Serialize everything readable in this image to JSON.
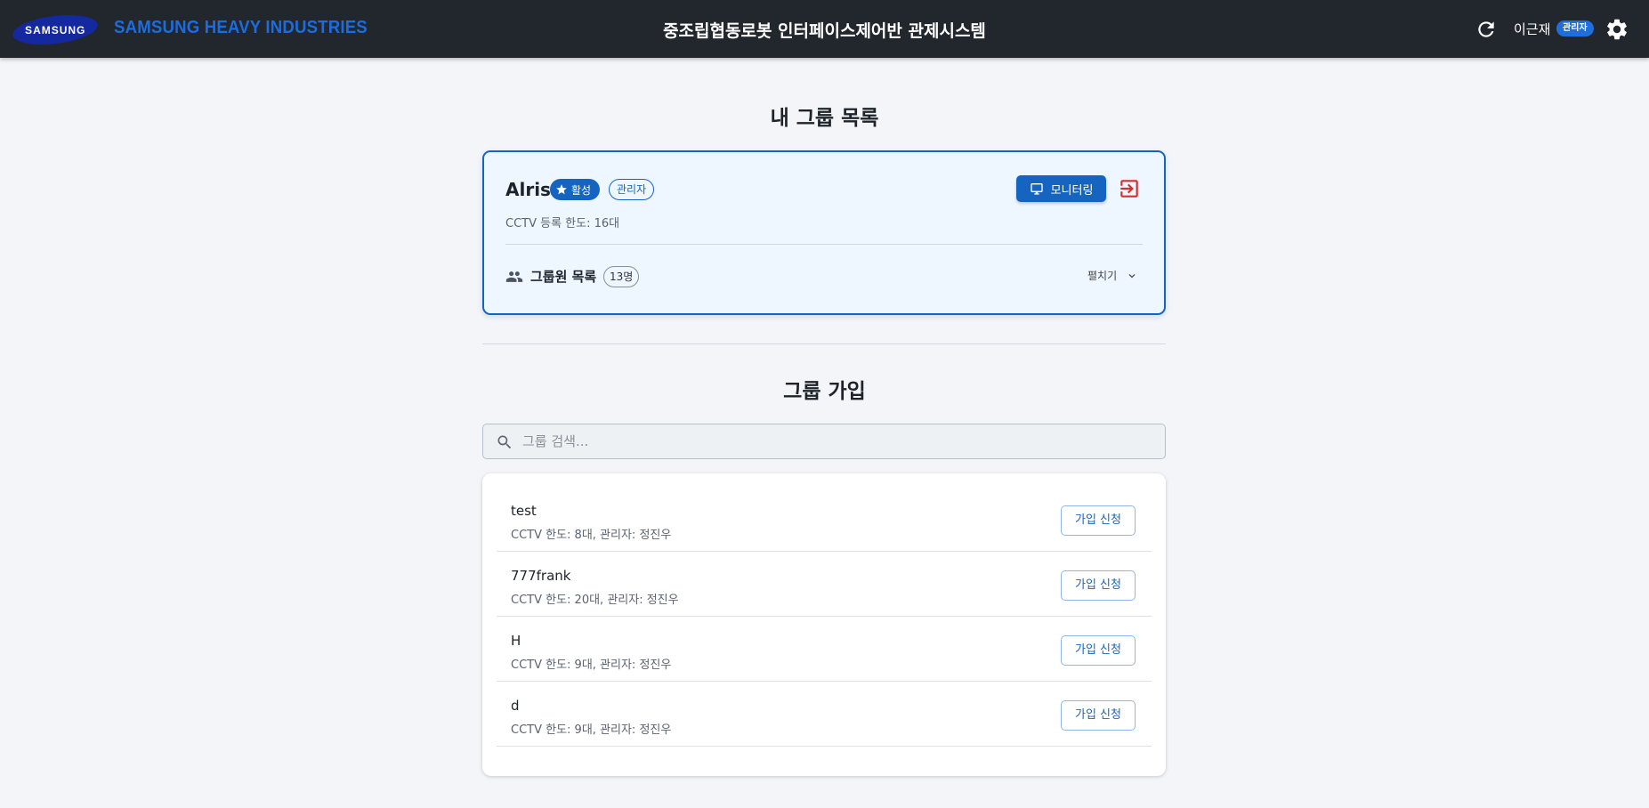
{
  "header": {
    "logo_text": "SAMSUNG",
    "brand": "SAMSUNG HEAVY INDUSTRIES",
    "title": "중조립협동로봇 인터페이스제어반 관제시스템",
    "user_name": "이근재",
    "user_role": "관리자",
    "icons": [
      "refresh-icon",
      "gear-icon"
    ]
  },
  "my_groups": {
    "title": "내 그룹 목록",
    "group": {
      "name": "Alris",
      "active_label": "활성",
      "role_label": "관리자",
      "monitor_label": "모니터링",
      "cctv_limit": "CCTV 등록 한도: 16대",
      "members_label": "그룹원 목록",
      "members_count": "13명",
      "expand_label": "펼치기"
    }
  },
  "join": {
    "title": "그룹 가입",
    "search_placeholder": "그룹 검색...",
    "groups": [
      {
        "name": "test",
        "desc": "CCTV 한도: 8대, 관리자: 정진우",
        "button": "가입 신청"
      },
      {
        "name": "777frank",
        "desc": "CCTV 한도: 20대, 관리자: 정진우",
        "button": "가입 신청"
      },
      {
        "name": "H",
        "desc": "CCTV 한도: 9대, 관리자: 정진우",
        "button": "가입 신청"
      },
      {
        "name": "d",
        "desc": "CCTV 한도: 9대, 관리자: 정진우",
        "button": "가입 신청"
      }
    ]
  },
  "colors": {
    "header_bg": "#22272e",
    "brand_blue": "#1b6ce0",
    "primary": "#1565c0",
    "leave_red": "#d32f2f",
    "page_bg": "#f3f5f9"
  }
}
